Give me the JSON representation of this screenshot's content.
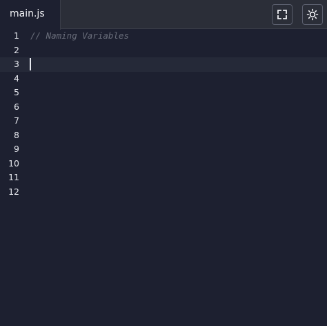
{
  "tab": {
    "filename": "main.js"
  },
  "toolbar": {
    "fullscreen_icon": "fullscreen-icon",
    "theme_icon": "sun-icon"
  },
  "editor": {
    "active_line": 3,
    "lines": [
      {
        "number": "1",
        "code": "// Naming Variables"
      },
      {
        "number": "2",
        "code": ""
      },
      {
        "number": "3",
        "code": ""
      },
      {
        "number": "4",
        "code": ""
      },
      {
        "number": "5",
        "code": ""
      },
      {
        "number": "6",
        "code": ""
      },
      {
        "number": "7",
        "code": ""
      },
      {
        "number": "8",
        "code": ""
      },
      {
        "number": "9",
        "code": ""
      },
      {
        "number": "10",
        "code": ""
      },
      {
        "number": "11",
        "code": ""
      },
      {
        "number": "12",
        "code": ""
      }
    ]
  },
  "colors": {
    "background": "#1d2030",
    "topbar": "#2b2e38",
    "active_line": "#252938",
    "comment": "#6a6e7b",
    "text": "#e6e8ee"
  }
}
